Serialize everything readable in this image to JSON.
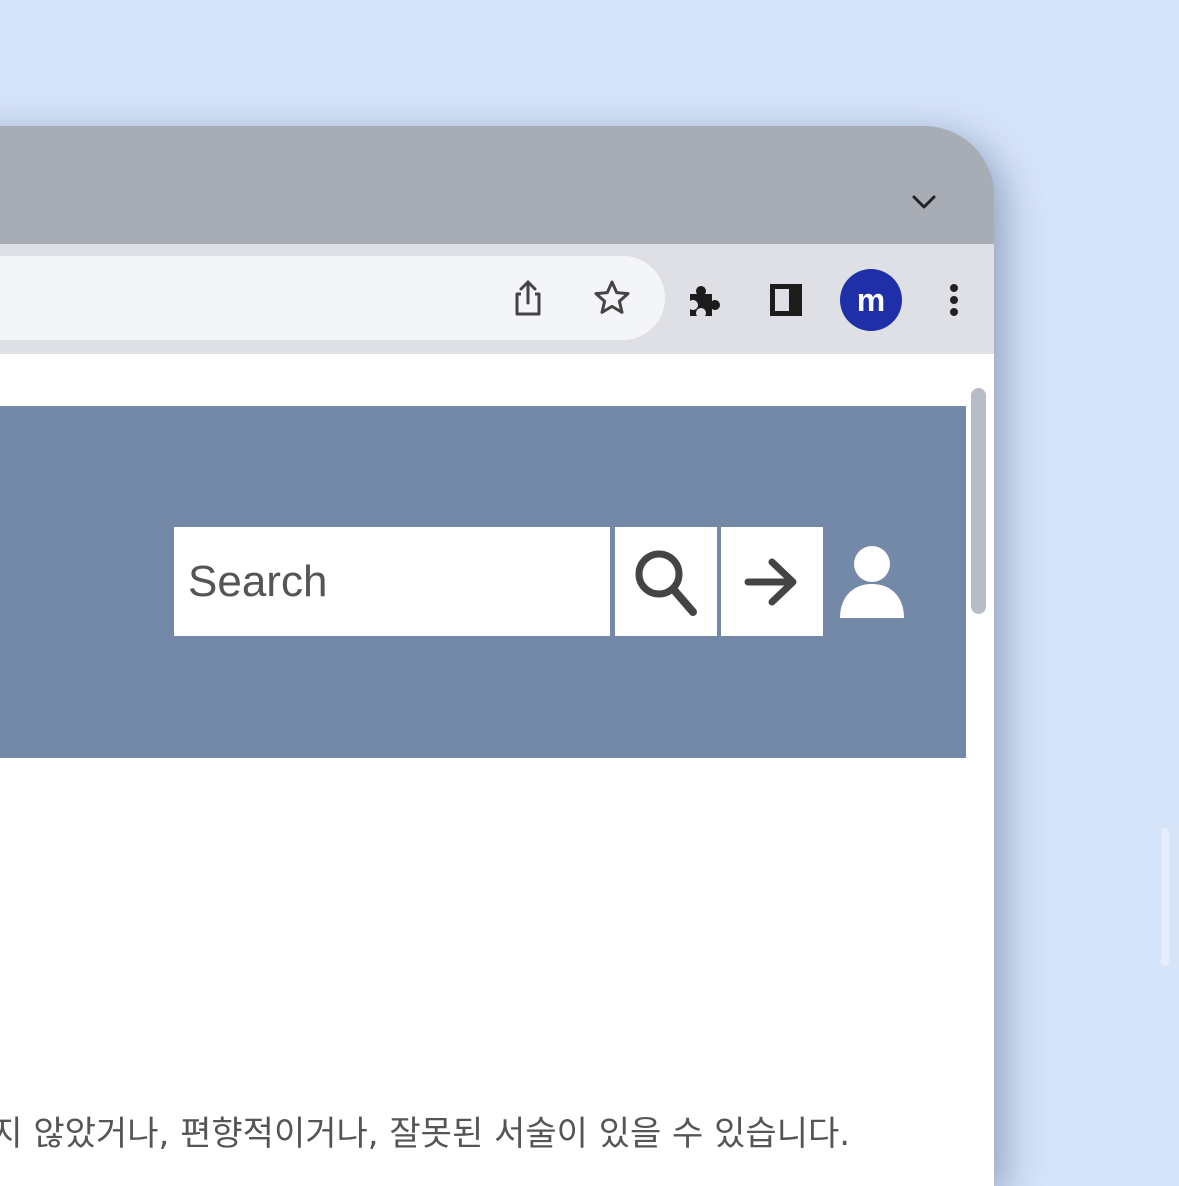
{
  "browser": {
    "tab_menu_icon": "chevron-down-icon",
    "omnibox_icons": [
      "share-icon",
      "star-icon"
    ],
    "toolbar_icons": [
      "extensions-puzzle-icon",
      "side-panel-icon",
      "more-vert-icon"
    ],
    "profile_initial": "m",
    "profile_color": "#1f2fa8"
  },
  "header": {
    "background_color": "#7489a8",
    "search": {
      "placeholder": "Search",
      "value": ""
    },
    "search_button_icon": "magnifier-icon",
    "go_button_icon": "arrow-right-icon",
    "user_icon": "user-icon"
  },
  "page": {
    "disclaimer": "되지 않았거나, 편향적이거나, 잘못된 서술이 있을 수 있습니다."
  }
}
